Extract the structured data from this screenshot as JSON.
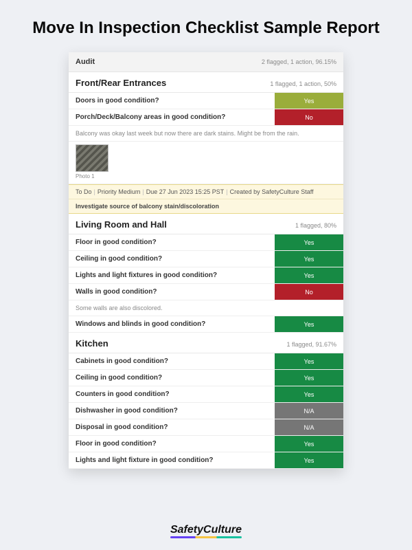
{
  "page_title": "Move In Inspection Checklist Sample Report",
  "audit": {
    "label": "Audit",
    "stats": "2 flagged, 1 action, 96.15%"
  },
  "sections": [
    {
      "title": "Front/Rear Entrances",
      "stats": "1 flagged, 1 action, 50%",
      "items": [
        {
          "label": "Doors in good condition?",
          "status": "Yes",
          "class": "s-yes-olive"
        },
        {
          "label": "Porch/Deck/Balcony areas in good condition?",
          "status": "No",
          "class": "s-no",
          "note": "Balcony was okay last week but now there are dark stains. Might be from the rain.",
          "photo": {
            "caption": "Photo 1"
          }
        }
      ],
      "action": {
        "status": "To Do",
        "priority": "Priority Medium",
        "due": "Due 27 Jun 2023 15:25 PST",
        "created_by": "Created by SafetyCulture Staff",
        "description": "Investigate source of balcony stain/discoloration"
      }
    },
    {
      "title": "Living Room and Hall",
      "stats": "1 flagged, 80%",
      "items": [
        {
          "label": "Floor in good condition?",
          "status": "Yes",
          "class": "s-yes"
        },
        {
          "label": "Ceiling in good condition?",
          "status": "Yes",
          "class": "s-yes"
        },
        {
          "label": "Lights and light fixtures in good condition?",
          "status": "Yes",
          "class": "s-yes"
        },
        {
          "label": "Walls in good condition?",
          "status": "No",
          "class": "s-no",
          "note": "Some walls are also discolored."
        },
        {
          "label": "Windows and blinds in good condition?",
          "status": "Yes",
          "class": "s-yes"
        }
      ]
    },
    {
      "title": "Kitchen",
      "stats": "1 flagged, 91.67%",
      "items": [
        {
          "label": "Cabinets in good condition?",
          "status": "Yes",
          "class": "s-yes"
        },
        {
          "label": "Ceiling in good condition?",
          "status": "Yes",
          "class": "s-yes"
        },
        {
          "label": "Counters in good condition?",
          "status": "Yes",
          "class": "s-yes"
        },
        {
          "label": "Dishwasher in good condition?",
          "status": "N/A",
          "class": "s-na"
        },
        {
          "label": "Disposal in good condition?",
          "status": "N/A",
          "class": "s-na"
        },
        {
          "label": "Floor in good condition?",
          "status": "Yes",
          "class": "s-yes"
        },
        {
          "label": "Lights and light fixture in good condition?",
          "status": "Yes",
          "class": "s-yes"
        }
      ]
    }
  ],
  "footer_brand": "SafetyCulture"
}
